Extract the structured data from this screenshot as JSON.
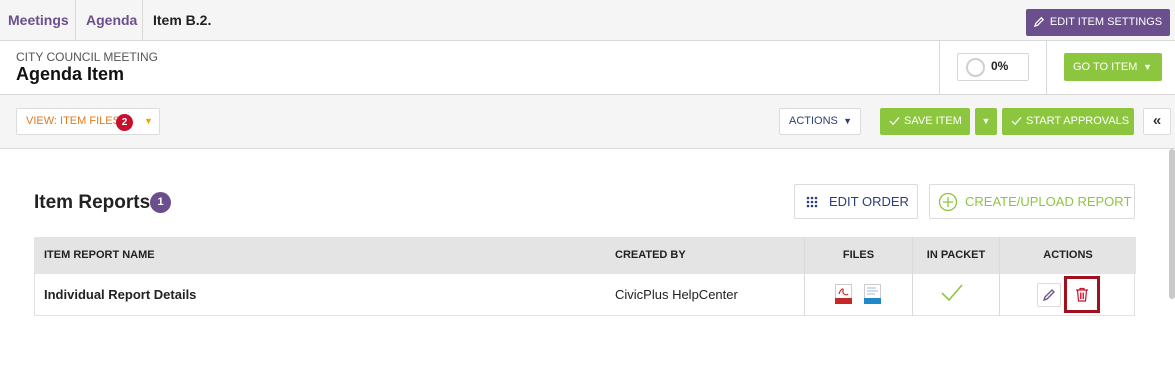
{
  "breadcrumb": {
    "items": [
      "Meetings",
      "Agenda"
    ],
    "current": "Item B.2."
  },
  "header": {
    "edit_settings_label": "EDIT ITEM SETTINGS",
    "subtitle": "CITY COUNCIL MEETING",
    "title": "Agenda Item",
    "progress_percent": "0%",
    "progress_value": 0,
    "goto_label": "GO TO ITEM"
  },
  "toolbar": {
    "view_label": "VIEW: ITEM FILES",
    "view_badge": "2",
    "actions_label": "ACTIONS",
    "save_label": "SAVE ITEM",
    "start_approvals_label": "START APPROVALS",
    "collapse_glyph": "«"
  },
  "section": {
    "title": "Item Reports",
    "count": "1",
    "edit_order_label": "EDIT ORDER",
    "create_label": "CREATE/UPLOAD REPORT"
  },
  "table": {
    "columns": [
      "ITEM REPORT NAME",
      "CREATED BY",
      "FILES",
      "IN PACKET",
      "ACTIONS"
    ],
    "rows": [
      {
        "name": "Individual Report Details",
        "created_by": "CivicPlus HelpCenter",
        "files": [
          "pdf-file-icon",
          "document-file-icon"
        ],
        "in_packet": true,
        "actions": [
          "edit-icon",
          "trash-icon"
        ]
      }
    ]
  },
  "colors": {
    "purple": "#6b4f8c",
    "green": "#8cc63f",
    "orange": "#e07a1f",
    "red_badge": "#c8102e",
    "highlight": "#a0101f",
    "navy": "#2c3e7a"
  }
}
